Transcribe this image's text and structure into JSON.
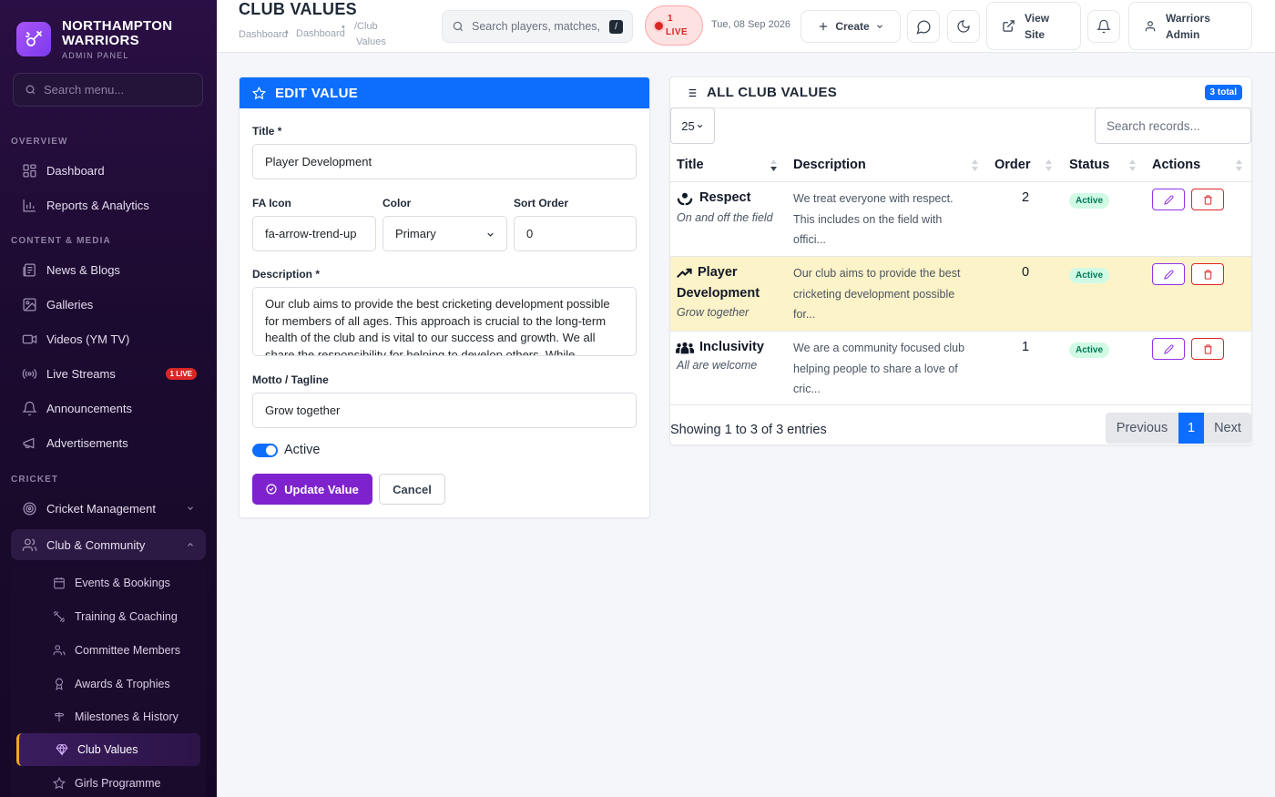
{
  "brand": {
    "name_line1": "NORTHAMPTON",
    "name_line2": "WARRIORS",
    "subtitle": "ADMIN PANEL"
  },
  "sidebar": {
    "search_placeholder": "Search menu...",
    "sections": {
      "overview": "OVERVIEW",
      "content": "CONTENT & MEDIA",
      "cricket": "CRICKET"
    },
    "items": {
      "dashboard": "Dashboard",
      "reports": "Reports & Analytics",
      "news": "News & Blogs",
      "galleries": "Galleries",
      "videos": "Videos (YM TV)",
      "live_streams": "Live Streams",
      "live_badge": "1 LIVE",
      "announcements": "Announcements",
      "advertisements": "Advertisements",
      "cricket_management": "Cricket Management",
      "club_community": "Club & Community"
    },
    "sub_items": {
      "events": "Events & Bookings",
      "training": "Training & Coaching",
      "committee": "Committee Members",
      "awards": "Awards & Trophies",
      "milestones": "Milestones & History",
      "club_values": "Club Values",
      "girls": "Girls Programme"
    }
  },
  "header": {
    "page_title": "CLUB VALUES",
    "breadcrumbs": [
      "Dashboard",
      "Dashboard",
      "/Club",
      "Values"
    ],
    "search_placeholder": "Search players, matches, r",
    "search_shortcut": "/",
    "live_count": "1",
    "live_label": "LIVE",
    "date": "Tue, 08 Sep 2026",
    "create_label": "Create",
    "view_site_line1": "View",
    "view_site_line2": "Site",
    "user_line1": "Warriors",
    "user_line2": "Admin"
  },
  "edit_form": {
    "heading": "EDIT VALUE",
    "title_label": "Title *",
    "title_value": "Player Development",
    "icon_label": "FA Icon",
    "icon_value": "fa-arrow-trend-up",
    "color_label": "Color",
    "color_value": "Primary",
    "sort_label": "Sort Order",
    "sort_value": "0",
    "description_label": "Description *",
    "description_value": "Our club aims to provide the best cricketing development possible for members of all ages. This approach is crucial to the long-term health of the club and is vital to our success and growth. We all share the responsibility for helping to develop others. While",
    "motto_label": "Motto / Tagline",
    "motto_value": "Grow together",
    "active_label": "Active",
    "active": true,
    "update_label": "Update Value",
    "cancel_label": "Cancel"
  },
  "list": {
    "heading": "ALL CLUB VALUES",
    "total_badge": "3 total",
    "page_length": "25",
    "search_placeholder": "Search records...",
    "columns": [
      "Title",
      "Description",
      "Order",
      "Status",
      "Actions"
    ],
    "rows": [
      {
        "title": "Respect",
        "motto": "On and off the field",
        "desc_lines": [
          "We treat everyone with respect.",
          "This includes on the field with",
          "offici..."
        ],
        "order": "2",
        "status": "Active",
        "icon": "hands-holding-icon",
        "highlighted": false
      },
      {
        "title_line1": "Player",
        "title_line2": "Development",
        "motto": "Grow together",
        "desc_lines": [
          "Our club aims to provide the best",
          "cricketing development possible",
          "for..."
        ],
        "order": "0",
        "status": "Active",
        "icon": "arrow-trend-up-icon",
        "highlighted": true
      },
      {
        "title": "Inclusivity",
        "motto": "All are welcome",
        "desc_lines": [
          "We are a community focused club",
          "helping people to share a love of",
          "cric..."
        ],
        "order": "1",
        "status": "Active",
        "icon": "people-group-icon",
        "highlighted": false
      }
    ],
    "info": "Showing 1 to 3 of 3 entries",
    "pagination": {
      "previous": "Previous",
      "current": "1",
      "next": "Next"
    }
  },
  "colors": {
    "primary_blue": "#0d6efd",
    "purple": "#7e22ce",
    "sidebar_bg": "#1c0b30",
    "accent_orange": "#f5a623",
    "danger": "#dc2626",
    "highlight_row": "#fdf3c8"
  }
}
